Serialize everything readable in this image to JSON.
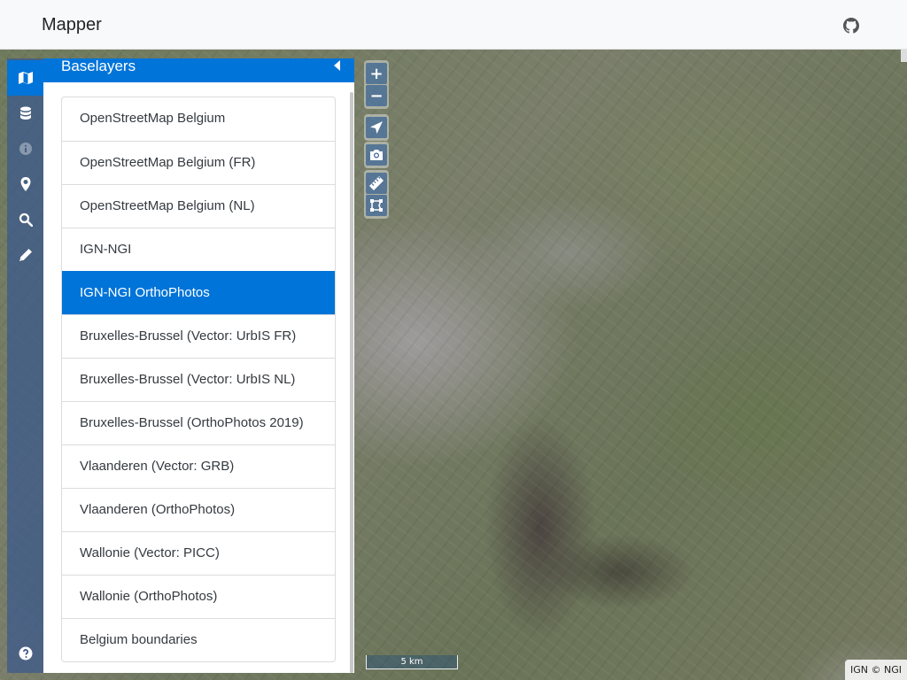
{
  "header": {
    "brand": "Mapper",
    "github_icon": "github-icon"
  },
  "sidebar": {
    "tabs": [
      {
        "icon": "map-icon",
        "active": true
      },
      {
        "icon": "database-icon",
        "active": false
      },
      {
        "icon": "info-icon",
        "active": false,
        "disabled": true
      },
      {
        "icon": "map-marker-icon",
        "active": false
      },
      {
        "icon": "search-icon",
        "active": false
      },
      {
        "icon": "pencil-icon",
        "active": false
      },
      {
        "icon": "question-icon",
        "active": false
      }
    ],
    "pane_title": "Baselayers",
    "collapse_icon": "caret-left-icon",
    "layers": [
      "OpenStreetMap Belgium",
      "OpenStreetMap Belgium (FR)",
      "OpenStreetMap Belgium (NL)",
      "IGN-NGI",
      "IGN-NGI OrthoPhotos",
      "Bruxelles-Brussel (Vector: UrbIS FR)",
      "Bruxelles-Brussel (Vector: UrbIS NL)",
      "Bruxelles-Brussel (OrthoPhotos 2019)",
      "Vlaanderen (Vector: GRB)",
      "Vlaanderen (OrthoPhotos)",
      "Wallonie (Vector: PICC)",
      "Wallonie (OrthoPhotos)",
      "Belgium boundaries"
    ],
    "active_layer": "IGN-NGI OrthoPhotos"
  },
  "map": {
    "controls": {
      "zoom_in": "+",
      "zoom_out": "−",
      "icons": [
        "location-arrow-icon",
        "camera-icon",
        "ruler-icon",
        "draw-polygon-icon"
      ]
    },
    "scale_label": "5 km",
    "attribution": "IGN © NGI"
  },
  "colors": {
    "accent": "#0074d9",
    "header_bg": "#f8f9fa"
  }
}
